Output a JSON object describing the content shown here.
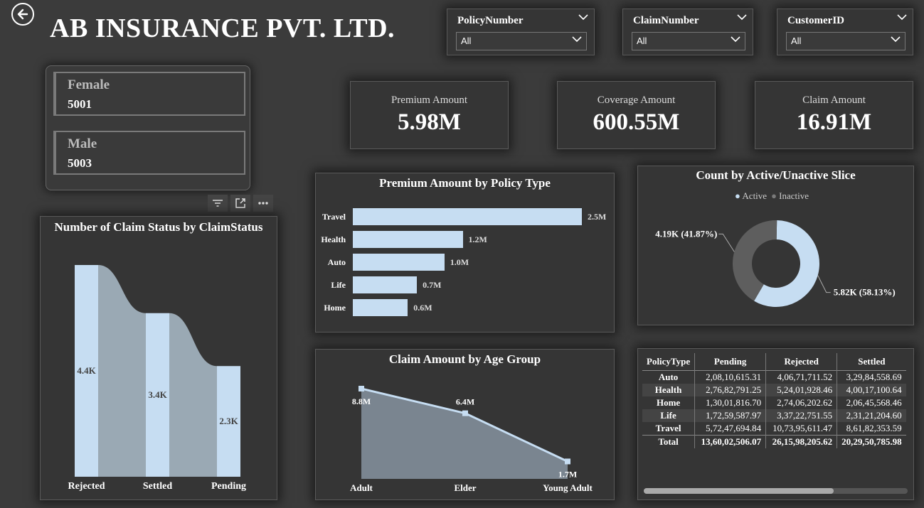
{
  "header": {
    "title": "AB INSURANCE PVT. LTD."
  },
  "slicers": [
    {
      "label": "PolicyNumber",
      "value": "All"
    },
    {
      "label": "ClaimNumber",
      "value": "All"
    },
    {
      "label": "CustomerID",
      "value": "All"
    }
  ],
  "gender": {
    "female_label": "Female",
    "female_value": "5001",
    "male_label": "Male",
    "male_value": "5003"
  },
  "kpis": [
    {
      "label": "Premium Amount",
      "value": "5.98M"
    },
    {
      "label": "Coverage Amount",
      "value": "600.55M"
    },
    {
      "label": "Claim Amount",
      "value": "16.91M"
    }
  ],
  "colors": {
    "bar": "#c6ddf2",
    "ribbon": "#9aa9b4",
    "area": "#7a8590",
    "inactive": "#5e5e5e"
  },
  "chart_data": [
    {
      "type": "bar",
      "title": "Number of Claim Status by ClaimStatus",
      "categories": [
        "Rejected",
        "Settled",
        "Pending"
      ],
      "values": [
        4400,
        3400,
        2300
      ],
      "data_labels": [
        "4.4K",
        "3.4K",
        "2.3K"
      ]
    },
    {
      "type": "bar",
      "title": "Premium Amount by Policy Type",
      "categories": [
        "Travel",
        "Health",
        "Auto",
        "Life",
        "Home"
      ],
      "values": [
        2.5,
        1.2,
        1.0,
        0.7,
        0.6
      ],
      "data_labels": [
        "2.5M",
        "1.2M",
        "1.0M",
        "0.7M",
        "0.6M"
      ]
    },
    {
      "type": "pie",
      "title": "Count by Active/Unactive Slice",
      "legend": [
        "Active",
        "Inactive"
      ],
      "values": [
        5.82,
        4.19
      ],
      "data_labels": [
        "5.82K (58.13%)",
        "4.19K (41.87%)"
      ]
    },
    {
      "type": "area",
      "title": "Claim Amount by Age Group",
      "categories": [
        "Adult",
        "Elder",
        "Young Adult"
      ],
      "values": [
        8.8,
        6.4,
        1.7
      ],
      "data_labels": [
        "8.8M",
        "6.4M",
        "1.7M"
      ]
    },
    {
      "type": "table",
      "columns": [
        "PolicyType",
        "Pending",
        "Rejected",
        "Settled"
      ],
      "rows": [
        [
          "Auto",
          "2,08,10,615.31",
          "4,06,71,711.52",
          "3,29,84,558.69"
        ],
        [
          "Health",
          "2,76,82,791.25",
          "5,24,01,928.46",
          "4,00,17,100.64"
        ],
        [
          "Home",
          "1,30,01,816.70",
          "2,74,06,202.62",
          "2,06,45,568.46"
        ],
        [
          "Life",
          "1,72,59,587.97",
          "3,37,22,751.55",
          "2,31,21,204.60"
        ],
        [
          "Travel",
          "5,72,47,694.84",
          "10,73,95,611.47",
          "8,61,82,353.59"
        ]
      ],
      "total": [
        "Total",
        "13,60,02,506.07",
        "26,15,98,205.62",
        "20,29,50,785.98"
      ]
    }
  ]
}
